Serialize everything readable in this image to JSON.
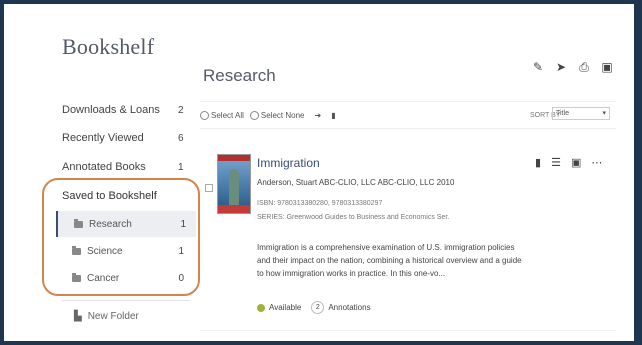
{
  "page": {
    "title": "Bookshelf"
  },
  "sidebar": {
    "items": [
      {
        "label": "Downloads & Loans",
        "count": "2"
      },
      {
        "label": "Recently Viewed",
        "count": "6"
      },
      {
        "label": "Annotated Books",
        "count": "1"
      }
    ],
    "saved_label": "Saved to Bookshelf",
    "folders": [
      {
        "label": "Research",
        "count": "1"
      },
      {
        "label": "Science",
        "count": "1"
      },
      {
        "label": "Cancer",
        "count": "0"
      }
    ],
    "new_folder": "New Folder"
  },
  "main": {
    "title": "Research",
    "toolbar": {
      "select_all": "Select All",
      "select_none": "Select None",
      "sort_label": "SORT BY",
      "sort_value": "Title"
    },
    "item": {
      "title": "Immigration",
      "meta": "Anderson, Stuart   ABC-CLIO, LLC  ABC-CLIO, LLC   2010",
      "isbn": "ISBN: 9780313380280, 9780313380297",
      "series": "SERIES: Greenwood Guides to Business and Economics Ser.",
      "description": "Immigration is a comprehensive examination of U.S. immigration policies and their impact on the nation, combining a historical overview and a guide to how immigration works in practice. In this one-vo...",
      "availability": "Available",
      "annotation_count": "2",
      "annotations_label": "Annotations"
    }
  },
  "colors": {
    "accent": "#3a4d75",
    "highlight": "#d5854a",
    "available": "#9db33a"
  }
}
